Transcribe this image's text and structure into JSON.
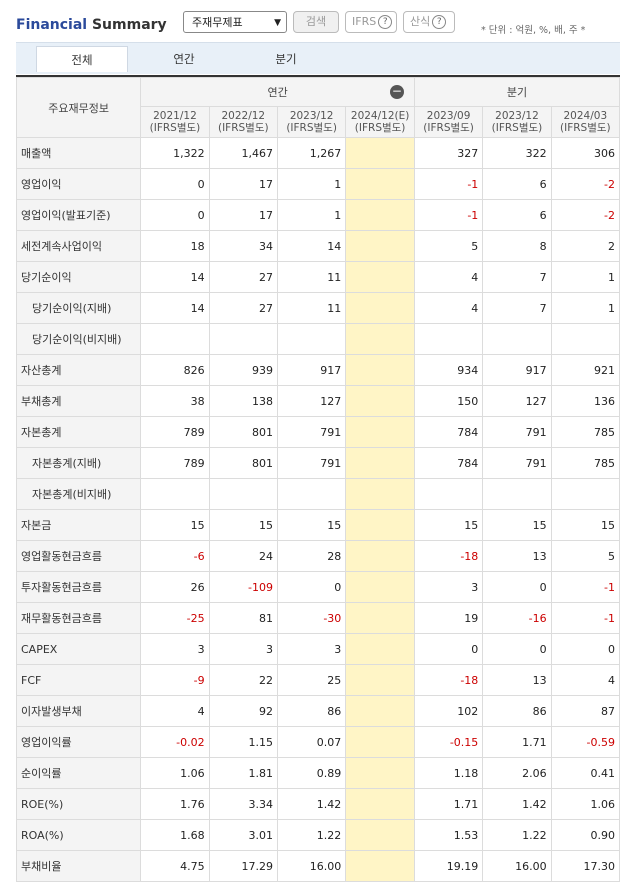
{
  "header": {
    "title_part1": "Financial",
    "title_part2": "Summary",
    "select_value": "주재무제표",
    "search_label": "검색",
    "ifrs_label": "IFRS",
    "formula_label": "산식",
    "help_glyph": "?",
    "unit_text": "* 단위 : 억원, %, 배, 주   *"
  },
  "tabs": [
    {
      "label": "전체"
    },
    {
      "label": "연간"
    },
    {
      "label": "분기"
    }
  ],
  "table": {
    "corner_label": "주요재무정보",
    "group_annual": "연간",
    "group_quarter": "분기",
    "collapse_glyph": "−",
    "columns": [
      {
        "period": "2021/12",
        "basis": "(IFRS별도)"
      },
      {
        "period": "2022/12",
        "basis": "(IFRS별도)"
      },
      {
        "period": "2023/12",
        "basis": "(IFRS별도)"
      },
      {
        "period": "2024/12(E)",
        "basis": "(IFRS별도)"
      },
      {
        "period": "2023/09",
        "basis": "(IFRS별도)"
      },
      {
        "period": "2023/12",
        "basis": "(IFRS별도)"
      },
      {
        "period": "2024/03",
        "basis": "(IFRS별도)"
      }
    ],
    "rows": [
      {
        "label": "매출액",
        "values": [
          "1,322",
          "1,467",
          "1,267",
          "",
          "327",
          "322",
          "306"
        ]
      },
      {
        "label": "영업이익",
        "values": [
          "0",
          "17",
          "1",
          "",
          "-1",
          "6",
          "-2"
        ]
      },
      {
        "label": "영업이익(발표기준)",
        "values": [
          "0",
          "17",
          "1",
          "",
          "-1",
          "6",
          "-2"
        ]
      },
      {
        "label": "세전계속사업이익",
        "values": [
          "18",
          "34",
          "14",
          "",
          "5",
          "8",
          "2"
        ]
      },
      {
        "label": "당기순이익",
        "values": [
          "14",
          "27",
          "11",
          "",
          "4",
          "7",
          "1"
        ]
      },
      {
        "label": "당기순이익(지배)",
        "values": [
          "14",
          "27",
          "11",
          "",
          "4",
          "7",
          "1"
        ]
      },
      {
        "label": "당기순이익(비지배)",
        "values": [
          "",
          "",
          "",
          "",
          "",
          "",
          ""
        ]
      },
      {
        "label": "자산총계",
        "values": [
          "826",
          "939",
          "917",
          "",
          "934",
          "917",
          "921"
        ]
      },
      {
        "label": "부채총계",
        "values": [
          "38",
          "138",
          "127",
          "",
          "150",
          "127",
          "136"
        ]
      },
      {
        "label": "자본총계",
        "values": [
          "789",
          "801",
          "791",
          "",
          "784",
          "791",
          "785"
        ]
      },
      {
        "label": "자본총계(지배)",
        "values": [
          "789",
          "801",
          "791",
          "",
          "784",
          "791",
          "785"
        ]
      },
      {
        "label": "자본총계(비지배)",
        "values": [
          "",
          "",
          "",
          "",
          "",
          "",
          ""
        ]
      },
      {
        "label": "자본금",
        "values": [
          "15",
          "15",
          "15",
          "",
          "15",
          "15",
          "15"
        ]
      },
      {
        "label": "영업활동현금흐름",
        "values": [
          "-6",
          "24",
          "28",
          "",
          "-18",
          "13",
          "5"
        ]
      },
      {
        "label": "투자활동현금흐름",
        "values": [
          "26",
          "-109",
          "0",
          "",
          "3",
          "0",
          "-1"
        ]
      },
      {
        "label": "재무활동현금흐름",
        "values": [
          "-25",
          "81",
          "-30",
          "",
          "19",
          "-16",
          "-1"
        ]
      },
      {
        "label": "CAPEX",
        "values": [
          "3",
          "3",
          "3",
          "",
          "0",
          "0",
          "0"
        ]
      },
      {
        "label": "FCF",
        "values": [
          "-9",
          "22",
          "25",
          "",
          "-18",
          "13",
          "4"
        ]
      },
      {
        "label": "이자발생부채",
        "values": [
          "4",
          "92",
          "86",
          "",
          "102",
          "86",
          "87"
        ]
      },
      {
        "label": "영업이익률",
        "values": [
          "-0.02",
          "1.15",
          "0.07",
          "",
          "-0.15",
          "1.71",
          "-0.59"
        ]
      },
      {
        "label": "순이익률",
        "values": [
          "1.06",
          "1.81",
          "0.89",
          "",
          "1.18",
          "2.06",
          "0.41"
        ]
      },
      {
        "label": "ROE(%)",
        "values": [
          "1.76",
          "3.34",
          "1.42",
          "",
          "1.71",
          "1.42",
          "1.06"
        ]
      },
      {
        "label": "ROA(%)",
        "values": [
          "1.68",
          "3.01",
          "1.22",
          "",
          "1.53",
          "1.22",
          "0.90"
        ]
      },
      {
        "label": "부채비율",
        "values": [
          "4.75",
          "17.29",
          "16.00",
          "",
          "19.19",
          "16.00",
          "17.30"
        ]
      }
    ]
  }
}
